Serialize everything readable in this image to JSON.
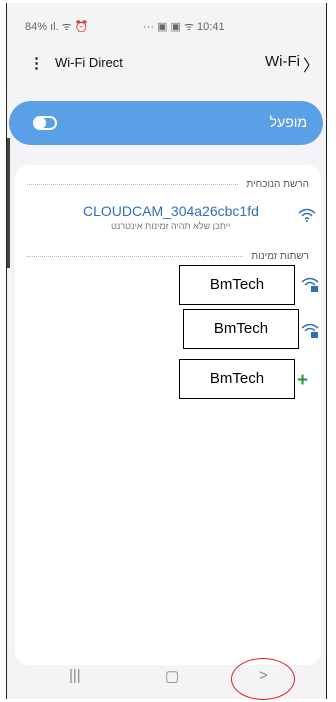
{
  "status_bar": {
    "left": "84% ıl. ᯤ ⏰",
    "right": "··· ▣ ▣ ᯤ 10:41"
  },
  "top_bar": {
    "title": "Wi-Fi Direct",
    "wifi_label": "Wi-Fi"
  },
  "toggle": {
    "label": "מופעל",
    "state": "on"
  },
  "current_network": {
    "header": "הרשת הנוכחית",
    "ssid": "CLOUDCAM_304a26cbc1fd",
    "subtitle": "ייתכן שלא תהיה זמינות אינטרנט"
  },
  "available_networks": {
    "header": "רשתות זמינות",
    "items": [
      {
        "name": "BmTech",
        "icon": "wifi-locked-icon"
      },
      {
        "name": "BmTech",
        "icon": "wifi-locked-icon"
      },
      {
        "name": "BmTech",
        "icon": "add-network-icon"
      }
    ]
  },
  "colors": {
    "accent": "#5aa0e6",
    "link": "#2f6fb8",
    "add": "#2b9a3a",
    "highlight": "#e02020"
  },
  "nav_bar": {
    "recents": "|||",
    "home": "▢",
    "back": ">"
  }
}
